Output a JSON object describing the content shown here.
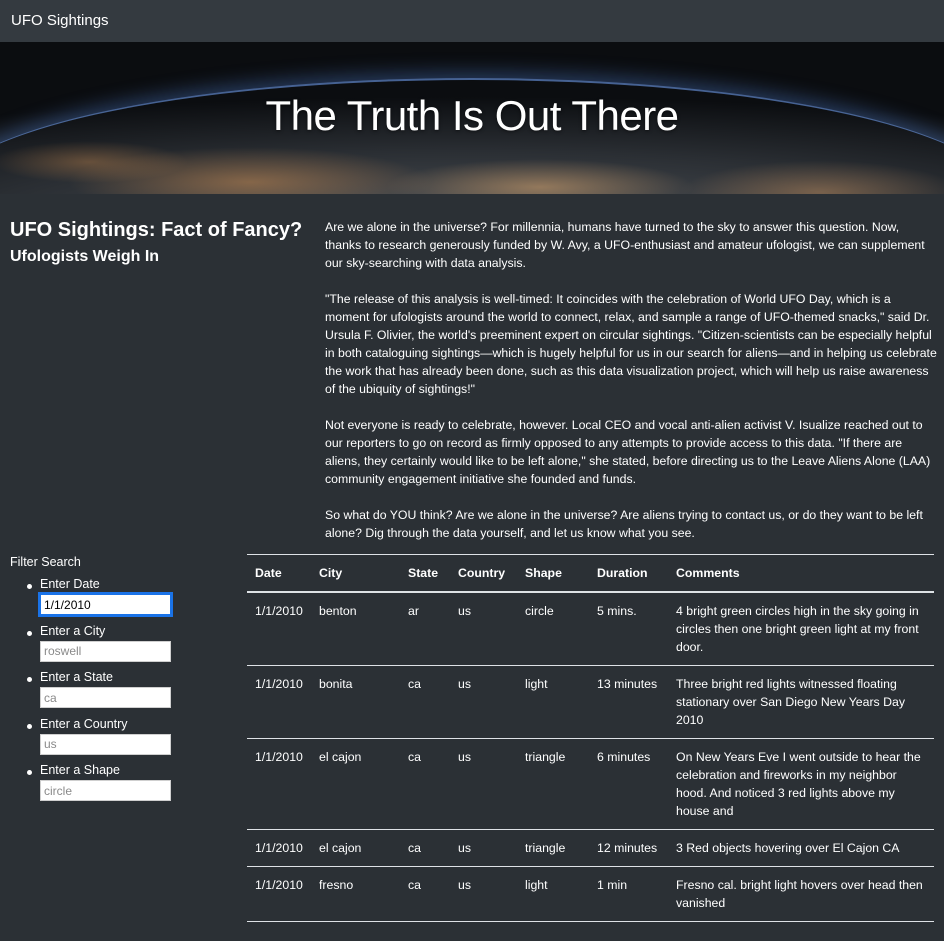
{
  "nav": {
    "brand": "UFO Sightings"
  },
  "hero": {
    "title": "The Truth Is Out There"
  },
  "intro": {
    "title": "UFO Sightings: Fact of Fancy?",
    "subtitle": "Ufologists Weigh In",
    "paragraphs": [
      "Are we alone in the universe? For millennia, humans have turned to the sky to answer this question. Now, thanks to research generously funded by W. Avy, a UFO-enthusiast and amateur ufologist, we can supplement our sky-searching with data analysis.",
      "\"The release of this analysis is well-timed: It coincides with the celebration of World UFO Day, which is a moment for ufologists around the world to connect, relax, and sample a range of UFO-themed snacks,\" said Dr. Ursula F. Olivier, the world's preeminent expert on circular sightings. \"Citizen-scientists can be especially helpful in both cataloguing sightings—which is hugely helpful for us in our search for aliens—and in helping us celebrate the work that has already been done, such as this data visualization project, which will help us raise awareness of the ubiquity of sightings!\"",
      "Not everyone is ready to celebrate, however. Local CEO and vocal anti-alien activist V. Isualize reached out to our reporters to go on record as firmly opposed to any attempts to provide access to this data. \"If there are aliens, they certainly would like to be left alone,\" she stated, before directing us to the Leave Aliens Alone (LAA) community engagement initiative she founded and funds.",
      "So what do YOU think? Are we alone in the universe? Are aliens trying to contact us, or do they want to be left alone? Dig through the data yourself, and let us know what you see."
    ]
  },
  "filters": {
    "heading": "Filter Search",
    "date": {
      "label": "Enter Date",
      "value": "1/1/2010",
      "placeholder": ""
    },
    "city": {
      "label": "Enter a City",
      "placeholder": "roswell"
    },
    "state": {
      "label": "Enter a State",
      "placeholder": "ca"
    },
    "country": {
      "label": "Enter a Country",
      "placeholder": "us"
    },
    "shape": {
      "label": "Enter a Shape",
      "placeholder": "circle"
    }
  },
  "table": {
    "headers": [
      "Date",
      "City",
      "State",
      "Country",
      "Shape",
      "Duration",
      "Comments"
    ],
    "rows": [
      [
        "1/1/2010",
        "benton",
        "ar",
        "us",
        "circle",
        "5 mins.",
        "4 bright green circles high in the sky going in circles then one bright green light at my front door."
      ],
      [
        "1/1/2010",
        "bonita",
        "ca",
        "us",
        "light",
        "13 minutes",
        "Three bright red lights witnessed floating stationary over San Diego New Years Day 2010"
      ],
      [
        "1/1/2010",
        "el cajon",
        "ca",
        "us",
        "triangle",
        "6 minutes",
        "On New Years Eve I went outside to hear the celebration and fireworks in my neighbor hood. And noticed 3 red lights above my house and"
      ],
      [
        "1/1/2010",
        "el cajon",
        "ca",
        "us",
        "triangle",
        "12 minutes",
        "3 Red objects hovering over El Cajon CA"
      ],
      [
        "1/1/2010",
        "fresno",
        "ca",
        "us",
        "light",
        "1 min",
        "Fresno cal. bright light hovers over head then vanished"
      ]
    ]
  }
}
